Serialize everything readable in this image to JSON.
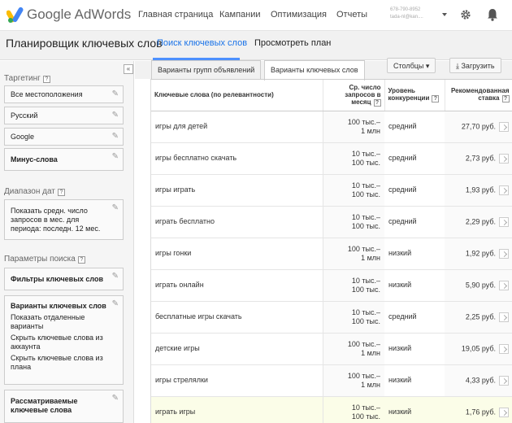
{
  "header": {
    "brand": "Google AdWords",
    "nav": [
      "Главная страница",
      "Кампании",
      "Оптимизация",
      "Отчеты"
    ],
    "account_line1": "678-790-8952",
    "account_line2": "tada-nl@kan...."
  },
  "subheader": {
    "page_title": "Планировщик ключевых слов",
    "tabs": [
      "Поиск ключевых слов",
      "Просмотреть план"
    ]
  },
  "sidebar": {
    "targeting_label": "Таргетинг",
    "targeting_items": [
      "Все местоположения",
      "Русский",
      "Google"
    ],
    "negative_label": "Минус-слова",
    "date_label": "Диапазон дат",
    "date_text": "Показать средн. число запросов в мес. для периода: последн. 12 мес.",
    "search_params_label": "Параметры поиска",
    "filters_label": "Фильтры ключевых слов",
    "variants_label": "Варианты ключевых слов",
    "variants_options": [
      "Показать отдаленные варианты",
      "Скрыть ключевые слова из аккаунта",
      "Скрыть ключевые слова из плана"
    ],
    "considered_label": "Рассматриваемые ключевые слова"
  },
  "results": {
    "tab_groups": "Варианты групп объявлений",
    "tab_keywords": "Варианты ключевых слов",
    "columns_button": "Столбцы",
    "download_button": "Загрузить",
    "headers": {
      "keyword": "Ключевые слова (по релевантности)",
      "volume": "Ср. число запросов в месяц",
      "competition": "Уровень конкуренции",
      "bid": "Рекомендованная ставка"
    },
    "rows": [
      {
        "keyword": "игры для детей",
        "vol1": "100 тыс.–",
        "vol2": "1 млн",
        "comp": "средний",
        "bid": "27,70 руб."
      },
      {
        "keyword": "игры бесплатно скачать",
        "vol1": "10 тыс.–",
        "vol2": "100 тыс.",
        "comp": "средний",
        "bid": "2,73 руб."
      },
      {
        "keyword": "игры играть",
        "vol1": "10 тыс.–",
        "vol2": "100 тыс.",
        "comp": "средний",
        "bid": "1,93 руб."
      },
      {
        "keyword": "играть бесплатно",
        "vol1": "10 тыс.–",
        "vol2": "100 тыс.",
        "comp": "средний",
        "bid": "2,29 руб."
      },
      {
        "keyword": "игры гонки",
        "vol1": "100 тыс.–",
        "vol2": "1 млн",
        "comp": "низкий",
        "bid": "1,92 руб."
      },
      {
        "keyword": "играть онлайн",
        "vol1": "10 тыс.–",
        "vol2": "100 тыс.",
        "comp": "низкий",
        "bid": "5,90 руб."
      },
      {
        "keyword": "бесплатные игры скачать",
        "vol1": "10 тыс.–",
        "vol2": "100 тыс.",
        "comp": "средний",
        "bid": "2,25 руб."
      },
      {
        "keyword": "детские игры",
        "vol1": "100 тыс.–",
        "vol2": "1 млн",
        "comp": "низкий",
        "bid": "19,05 руб."
      },
      {
        "keyword": "игры стрелялки",
        "vol1": "100 тыс.–",
        "vol2": "1 млн",
        "comp": "низкий",
        "bid": "4,33 руб."
      },
      {
        "keyword": "играть игры",
        "vol1": "10 тыс.–",
        "vol2": "100 тыс.",
        "comp": "низкий",
        "bid": "1,76 руб."
      }
    ]
  },
  "colors": {
    "accent": "#4d90fe",
    "highlight": "#fbfde8"
  },
  "icons": [
    "google-ads-logo-icon",
    "gear-icon",
    "bell-icon",
    "pencil-icon",
    "help-icon",
    "download-icon",
    "chart-icon"
  ]
}
